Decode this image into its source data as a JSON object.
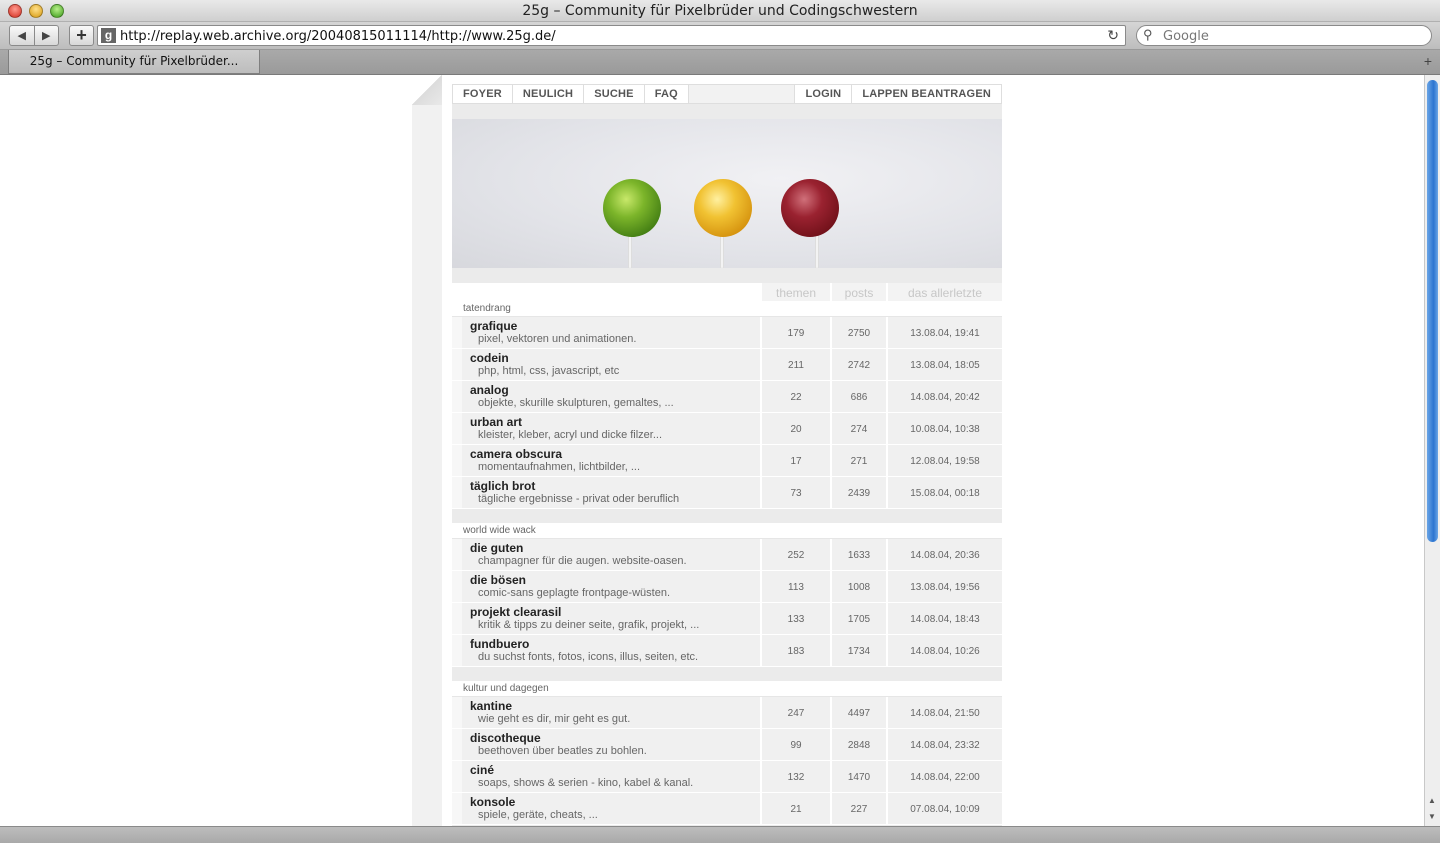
{
  "window": {
    "title": "25g – Community für Pixelbrüder und Codingschwestern"
  },
  "toolbar": {
    "back": "◀",
    "forward": "▶",
    "add": "+",
    "url": "http://replay.web.archive.org/20040815011114/http://www.25g.de/",
    "reload": "↻",
    "search_placeholder": "Google"
  },
  "tabs": [
    {
      "label": "25g – Community für Pixelbrüder..."
    }
  ],
  "nav": {
    "left": [
      "FOYER",
      "NEULICH",
      "SUCHE",
      "FAQ"
    ],
    "right": [
      "LOGIN",
      "LAPPEN BEANTRAGEN"
    ]
  },
  "table_header": {
    "themen": "themen",
    "posts": "posts",
    "last": "das allerletzte"
  },
  "sections": [
    {
      "title": "tatendrang",
      "forums": [
        {
          "name": "grafique",
          "desc": "pixel, vektoren und animationen.",
          "themen": "179",
          "posts": "2750",
          "last": "13.08.04, 19:41"
        },
        {
          "name": "codein",
          "desc": "php, html, css, javascript, etc",
          "themen": "211",
          "posts": "2742",
          "last": "13.08.04, 18:05"
        },
        {
          "name": "analog",
          "desc": "objekte, skurille skulpturen, gemaltes, ...",
          "themen": "22",
          "posts": "686",
          "last": "14.08.04, 20:42"
        },
        {
          "name": "urban art",
          "desc": "kleister, kleber, acryl und dicke filzer...",
          "themen": "20",
          "posts": "274",
          "last": "10.08.04, 10:38"
        },
        {
          "name": "camera obscura",
          "desc": "momentaufnahmen, lichtbilder, ...",
          "themen": "17",
          "posts": "271",
          "last": "12.08.04, 19:58"
        },
        {
          "name": "täglich brot",
          "desc": "tägliche ergebnisse - privat oder beruflich",
          "themen": "73",
          "posts": "2439",
          "last": "15.08.04, 00:18"
        }
      ]
    },
    {
      "title": "world wide wack",
      "forums": [
        {
          "name": "die guten",
          "desc": "champagner für die augen. website-oasen.",
          "themen": "252",
          "posts": "1633",
          "last": "14.08.04, 20:36"
        },
        {
          "name": "die bösen",
          "desc": "comic-sans geplagte frontpage-wüsten.",
          "themen": "113",
          "posts": "1008",
          "last": "13.08.04, 19:56"
        },
        {
          "name": "projekt clearasil",
          "desc": "kritik & tipps zu deiner seite, grafik, projekt, ...",
          "themen": "133",
          "posts": "1705",
          "last": "14.08.04, 18:43"
        },
        {
          "name": "fundbuero",
          "desc": "du suchst fonts, fotos, icons, illus, seiten, etc.",
          "themen": "183",
          "posts": "1734",
          "last": "14.08.04, 10:26"
        }
      ]
    },
    {
      "title": "kultur und dagegen",
      "forums": [
        {
          "name": "kantine",
          "desc": "wie geht es dir, mir geht es gut.",
          "themen": "247",
          "posts": "4497",
          "last": "14.08.04, 21:50"
        },
        {
          "name": "discotheque",
          "desc": "beethoven über beatles zu bohlen.",
          "themen": "99",
          "posts": "2848",
          "last": "14.08.04, 23:32"
        },
        {
          "name": "ciné",
          "desc": "soaps, shows & serien - kino, kabel & kanal.",
          "themen": "132",
          "posts": "1470",
          "last": "14.08.04, 22:00"
        },
        {
          "name": "konsole",
          "desc": "spiele, geräte, cheats, ...",
          "themen": "21",
          "posts": "227",
          "last": "07.08.04, 10:09"
        }
      ]
    }
  ],
  "colors": {
    "candy_green": "#5a9a20",
    "candy_yellow": "#e0a515",
    "candy_red": "#8a1a22",
    "scroll_accent": "#2b74d0"
  }
}
